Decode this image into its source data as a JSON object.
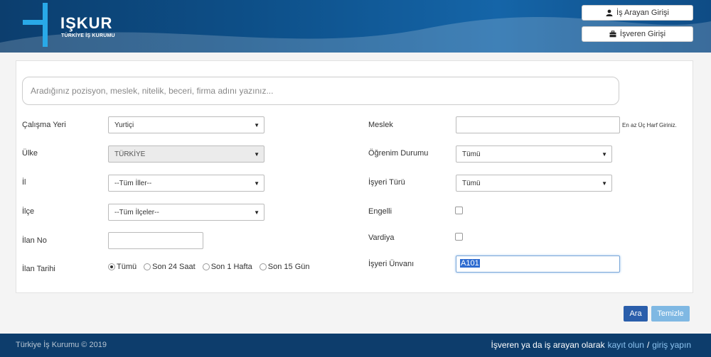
{
  "header": {
    "logo_title": "IŞKUR",
    "logo_subtitle": "TÜRKİYE İŞ KURUMU",
    "job_seeker_login": "İş Arayan Girişi",
    "employer_login": "İşveren Girişi"
  },
  "search": {
    "placeholder": "Aradığınız pozisyon, meslek, nitelik, beceri, firma adını yazınız..."
  },
  "form_left": {
    "work_location_label": "Çalışma Yeri",
    "work_location_value": "Yurtiçi",
    "country_label": "Ülke",
    "country_value": "TÜRKİYE",
    "province_label": "İl",
    "province_value": "--Tüm İller--",
    "district_label": "İlçe",
    "district_value": "--Tüm İlçeler--",
    "listing_no_label": "İlan No",
    "listing_no_value": "",
    "listing_date_label": "İlan Tarihi",
    "date_options": [
      "Tümü",
      "Son 24 Saat",
      "Son 1 Hafta",
      "Son 15 Gün"
    ],
    "date_selected": "Tümü"
  },
  "form_right": {
    "profession_label": "Meslek",
    "profession_value": "",
    "profession_hint": "En az Üç Harf Giriniz.",
    "education_label": "Öğrenim Durumu",
    "education_value": "Tümü",
    "workplace_type_label": "İşyeri Türü",
    "workplace_type_value": "Tümü",
    "disabled_label": "Engelli",
    "shift_label": "Vardiya",
    "workplace_title_label": "İşyeri Ünvanı",
    "workplace_title_value": "A101"
  },
  "actions": {
    "search_button": "Ara",
    "clear_button": "Temizle"
  },
  "footer": {
    "copyright": "Türkiye İş Kurumu © 2019",
    "cta_text": "İşveren ya da iş arayan olarak",
    "register_link": "kayıt olun",
    "separator": "/",
    "login_link": "giriş yapın"
  },
  "colors": {
    "header_bg": "#0d4f88",
    "footer_bg": "#0d3d6c",
    "primary_button": "#2a5eab",
    "secondary_button": "#7fb8e3"
  }
}
